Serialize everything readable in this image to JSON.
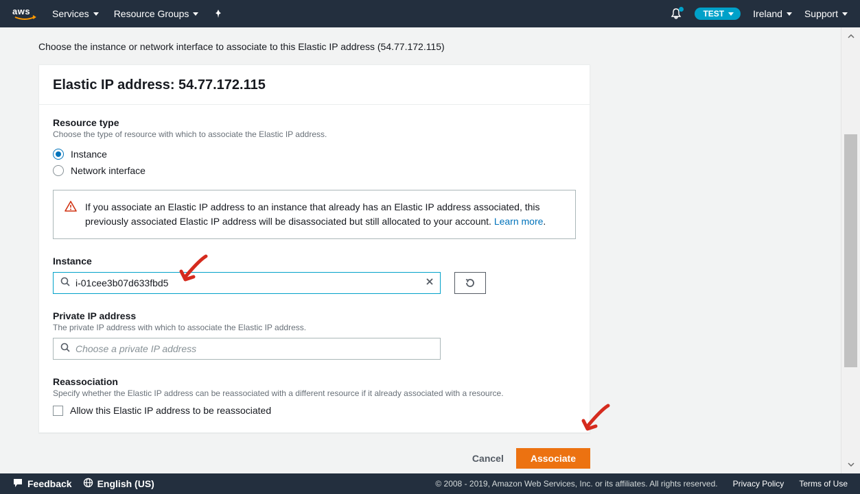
{
  "nav": {
    "services": "Services",
    "resource_groups": "Resource Groups",
    "account_pill": "TEST",
    "region": "Ireland",
    "support": "Support"
  },
  "page": {
    "subheader": "Choose the instance or network interface to associate to this Elastic IP address (54.77.172.115)",
    "card_title": "Elastic IP address: 54.77.172.115",
    "resource_type": {
      "label": "Resource type",
      "desc": "Choose the type of resource with which to associate the Elastic IP address.",
      "opt_instance": "Instance",
      "opt_eni": "Network interface"
    },
    "alert": {
      "text": "If you associate an Elastic IP address to an instance that already has an Elastic IP address associated, this previously associated Elastic IP address will be disassociated but still allocated to your account. ",
      "link": "Learn more"
    },
    "instance": {
      "label": "Instance",
      "value": "i-01cee3b07d633fbd5"
    },
    "private_ip": {
      "label": "Private IP address",
      "desc": "The private IP address with which to associate the Elastic IP address.",
      "placeholder": "Choose a private IP address"
    },
    "reassoc": {
      "label": "Reassociation",
      "desc": "Specify whether the Elastic IP address can be reassociated with a different resource if it already associated with a resource.",
      "checkbox": "Allow this Elastic IP address to be reassociated"
    },
    "actions": {
      "cancel": "Cancel",
      "associate": "Associate"
    }
  },
  "footer": {
    "feedback": "Feedback",
    "language": "English (US)",
    "copyright": "© 2008 - 2019, Amazon Web Services, Inc. or its affiliates. All rights reserved.",
    "privacy": "Privacy Policy",
    "terms": "Terms of Use"
  }
}
